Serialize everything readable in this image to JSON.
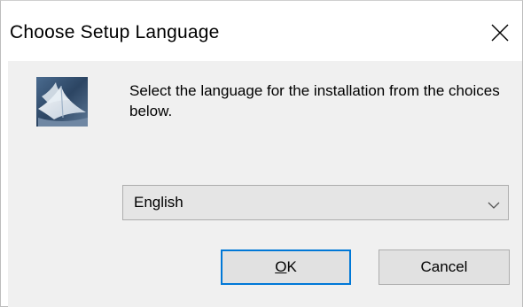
{
  "window": {
    "title": "Choose Setup Language",
    "close_icon": "close-icon"
  },
  "dialog": {
    "icon": "setup-installer-icon",
    "message": "Select the language for the installation from the choices below.",
    "language_select": {
      "selected": "English",
      "arrow_icon": "chevron-down-icon"
    },
    "buttons": {
      "ok_label": "OK",
      "ok_mnemonic": "O",
      "ok_rest": "K",
      "cancel_label": "Cancel"
    }
  },
  "colors": {
    "focus_border": "#0078d7",
    "dialog_background": "#f0f0f0",
    "button_face": "#e1e1e1"
  }
}
